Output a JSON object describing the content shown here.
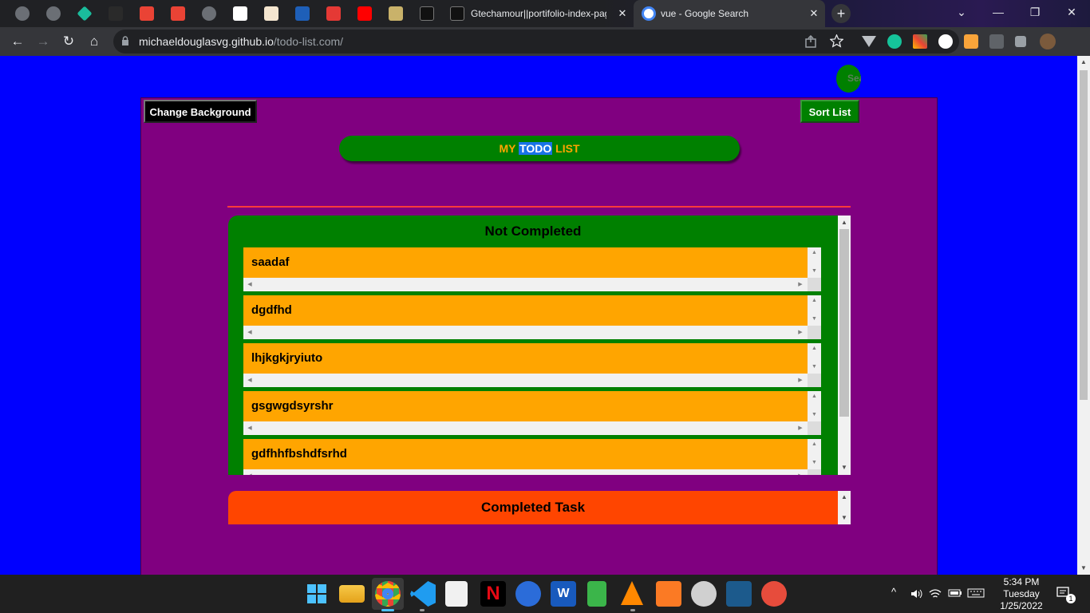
{
  "browser": {
    "tabs": [
      {
        "title": "Gtechamour||portifolio-index-page",
        "close": "✕"
      },
      {
        "title": "vue - Google Search",
        "close": "✕"
      }
    ],
    "new_tab": "+",
    "window": {
      "chevron": "⌄",
      "minimize": "—",
      "restore": "❐",
      "close": "✕"
    },
    "url_host": "michaeldouglasvg.github.io",
    "url_path": "/todo-list.com/",
    "nav": {
      "back": "←",
      "forward": "→",
      "reload": "↻",
      "home": "⌂"
    }
  },
  "page": {
    "search_button": "Search",
    "change_background": "Change Background",
    "sort_list": "Sort List",
    "title": {
      "part1": "MY ",
      "highlighted": "TODO",
      "part2": " LIST"
    },
    "not_completed": {
      "heading": "Not Completed",
      "items": [
        "saadaf",
        "dgdfhd",
        "lhjkgkjryiuto",
        "gsgwgdsyrshr",
        "gdfhhfbshdfsrhd"
      ]
    },
    "completed": {
      "heading": "Completed Task"
    }
  },
  "taskbar": {
    "clock_time": "5:34 PM",
    "clock_day": "Tuesday",
    "clock_date": "1/25/2022",
    "tray_chevron": "^",
    "notification_count": "1"
  },
  "colors": {
    "page_bg": "#0000ff",
    "app_bg": "#800080",
    "not_completed_panel": "#008000",
    "item_bg": "#ffa500",
    "completed_panel": "#ff4500",
    "divider": "#ff3b3b"
  }
}
